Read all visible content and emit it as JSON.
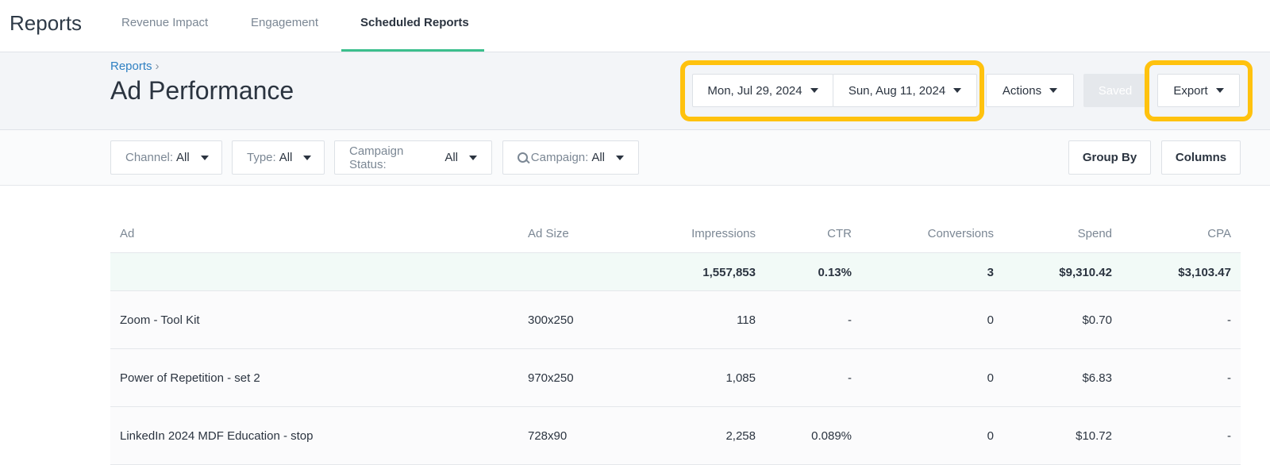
{
  "app": {
    "title": "Reports"
  },
  "tabs": [
    {
      "label": "Revenue Impact"
    },
    {
      "label": "Engagement"
    },
    {
      "label": "Scheduled Reports"
    }
  ],
  "header": {
    "breadcrumb": "Reports",
    "breadcrumb_sep": "›",
    "title": "Ad Performance",
    "start_date": "Mon, Jul 29, 2024",
    "end_date": "Sun, Aug 11, 2024",
    "actions_label": "Actions",
    "saved_label": "Saved",
    "export_label": "Export"
  },
  "filters": {
    "channel": {
      "label": "Channel:",
      "value": "All"
    },
    "type": {
      "label": "Type:",
      "value": "All"
    },
    "campaign_status": {
      "label": "Campaign Status:",
      "value": "All"
    },
    "campaign": {
      "label": "Campaign:",
      "value": "All"
    },
    "group_by_label": "Group By",
    "columns_label": "Columns"
  },
  "table": {
    "columns": [
      "Ad",
      "Ad Size",
      "Impressions",
      "CTR",
      "Conversions",
      "Spend",
      "CPA"
    ],
    "totals": {
      "impressions": "1,557,853",
      "ctr": "0.13%",
      "conversions": "3",
      "spend": "$9,310.42",
      "cpa": "$3,103.47"
    },
    "rows": [
      {
        "ad": "Zoom - Tool Kit",
        "size": "300x250",
        "impressions": "118",
        "ctr": "-",
        "conversions": "0",
        "spend": "$0.70",
        "cpa": "-"
      },
      {
        "ad": "Power of Repetition - set 2",
        "size": "970x250",
        "impressions": "1,085",
        "ctr": "-",
        "conversions": "0",
        "spend": "$6.83",
        "cpa": "-"
      },
      {
        "ad": "LinkedIn 2024 MDF Education - stop",
        "size": "728x90",
        "impressions": "2,258",
        "ctr": "0.089%",
        "conversions": "0",
        "spend": "$10.72",
        "cpa": "-"
      }
    ]
  },
  "colors": {
    "accent": "#3bbf8d",
    "link": "#2f80c2",
    "highlight": "#ffc20e"
  }
}
